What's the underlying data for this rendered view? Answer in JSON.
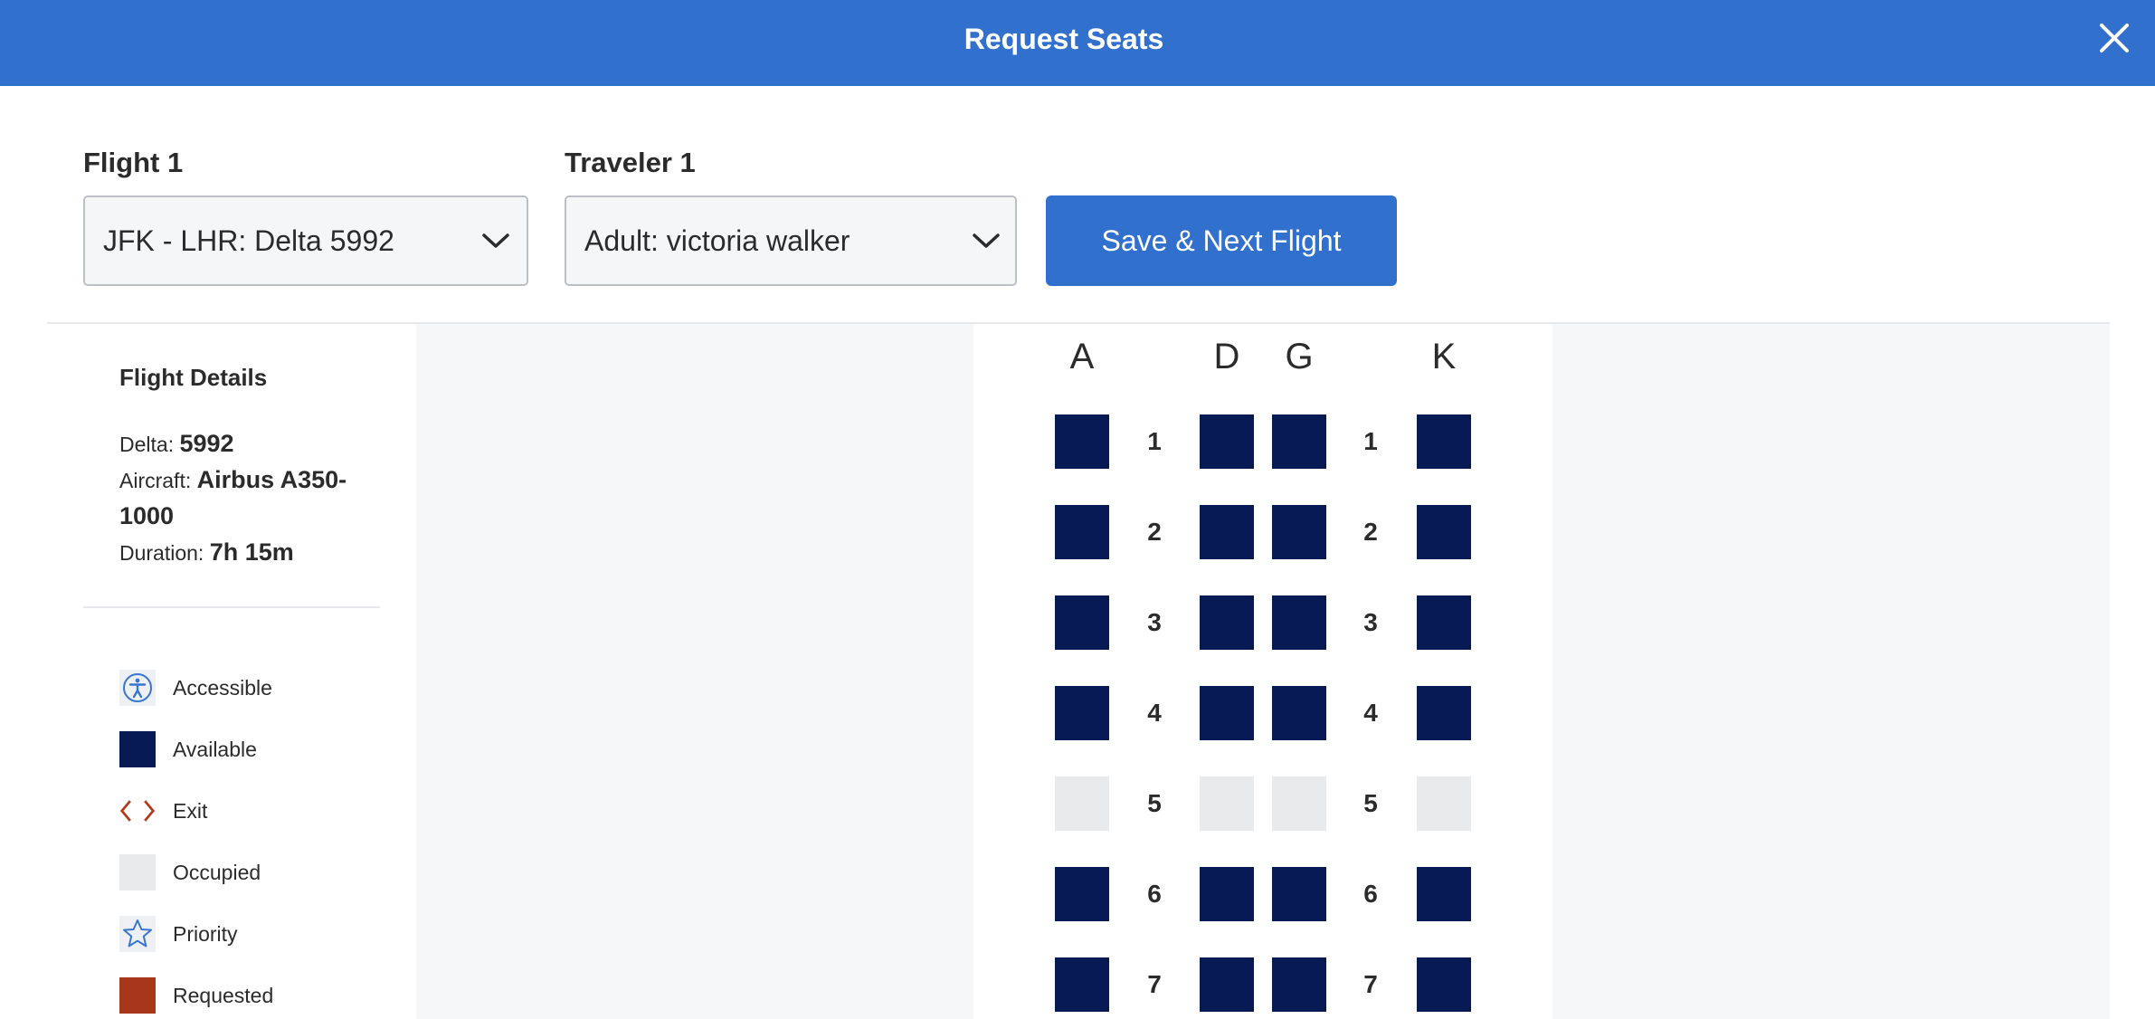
{
  "header": {
    "title": "Request Seats",
    "close_icon": "close-icon"
  },
  "selectors": {
    "flight_label": "Flight 1",
    "flight_value": "JFK - LHR: Delta 5992",
    "traveler_label": "Traveler 1",
    "traveler_value": "Adult: victoria walker",
    "save_button": "Save & Next Flight"
  },
  "flight_details": {
    "title": "Flight Details",
    "airline_label": "Delta:",
    "flight_number": "5992",
    "aircraft_label": "Aircraft:",
    "aircraft_line1": "Airbus A350-",
    "aircraft_line2": "1000",
    "duration_label": "Duration:",
    "duration": "7h 15m"
  },
  "legend": [
    {
      "label": "Accessible",
      "icon": "accessible-icon"
    },
    {
      "label": "Available",
      "icon": "available-swatch"
    },
    {
      "label": "Exit",
      "icon": "exit-icon"
    },
    {
      "label": "Occupied",
      "icon": "occupied-swatch"
    },
    {
      "label": "Priority",
      "icon": "star-icon"
    },
    {
      "label": "Requested",
      "icon": "requested-swatch"
    }
  ],
  "seat_map": {
    "columns": [
      "A",
      "D",
      "G",
      "K"
    ],
    "rows": [
      {
        "number": "1",
        "left": "1",
        "right": "1",
        "status": "available"
      },
      {
        "number": "2",
        "left": "2",
        "right": "2",
        "status": "available"
      },
      {
        "number": "3",
        "left": "3",
        "right": "3",
        "status": "available"
      },
      {
        "number": "4",
        "left": "4",
        "right": "4",
        "status": "available"
      },
      {
        "number": "5",
        "left": "5",
        "right": "5",
        "status": "occupied"
      },
      {
        "number": "6",
        "left": "6",
        "right": "6",
        "status": "available"
      },
      {
        "number": "7",
        "left": "7",
        "right": "7",
        "status": "available"
      }
    ]
  },
  "colors": {
    "brand_blue": "#3170cc",
    "available": "#071a54",
    "occupied": "#e9eaec",
    "requested": "#a8361b",
    "exit": "#b23a1c",
    "accent_icon": "#3a76d0"
  }
}
